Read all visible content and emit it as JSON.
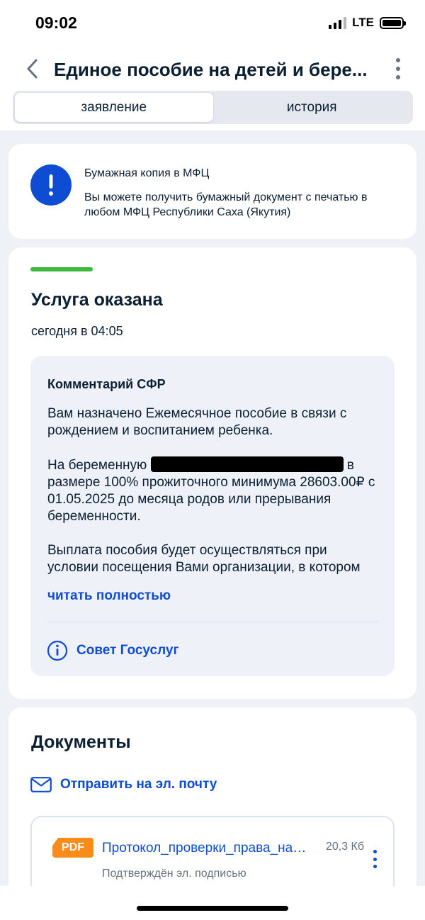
{
  "status_bar": {
    "time": "09:02",
    "network": "LTE"
  },
  "header": {
    "title": "Единое пособие на детей и бере..."
  },
  "tabs": [
    {
      "label": "заявление",
      "active": true
    },
    {
      "label": "история",
      "active": false
    }
  ],
  "notice": {
    "title": "Бумажная копия в МФЦ",
    "text": "Вы можете получить бумажный документ с печатью в любом МФЦ Республики Саха (Якутия)",
    "icon": "exclamation-icon"
  },
  "status": {
    "title": "Услуга оказана",
    "time": "сегодня в 04:05",
    "accent": "#3db93d"
  },
  "comment": {
    "title": "Комментарий СФР",
    "p1": "Вам назначено Ежемесячное пособие в связи с рождением и воспитанием ребенка.",
    "p2_prefix": "На беременную",
    "p2_suffix": "в размере 100% прожиточного минимума 28603.00₽ с 01.05.2025 до месяца родов или прерывания беременности.",
    "p3": "Выплата пособия будет осуществляться при условии посещения Вами организации, в котором",
    "read_more": "читать полностью",
    "advice": "Совет Госуслуг"
  },
  "documents": {
    "title": "Документы",
    "email_link": "Отправить на эл. почту",
    "files": [
      {
        "badge": "PDF",
        "name": "Протокол_проверки_права_на_пособие.pdf",
        "size": "20,3 Кб",
        "subtitle": "Подтверждён эл. подписью"
      }
    ]
  },
  "colors": {
    "primary": "#0d4cd3",
    "success": "#3db93d",
    "pdf": "#f98b1a"
  }
}
